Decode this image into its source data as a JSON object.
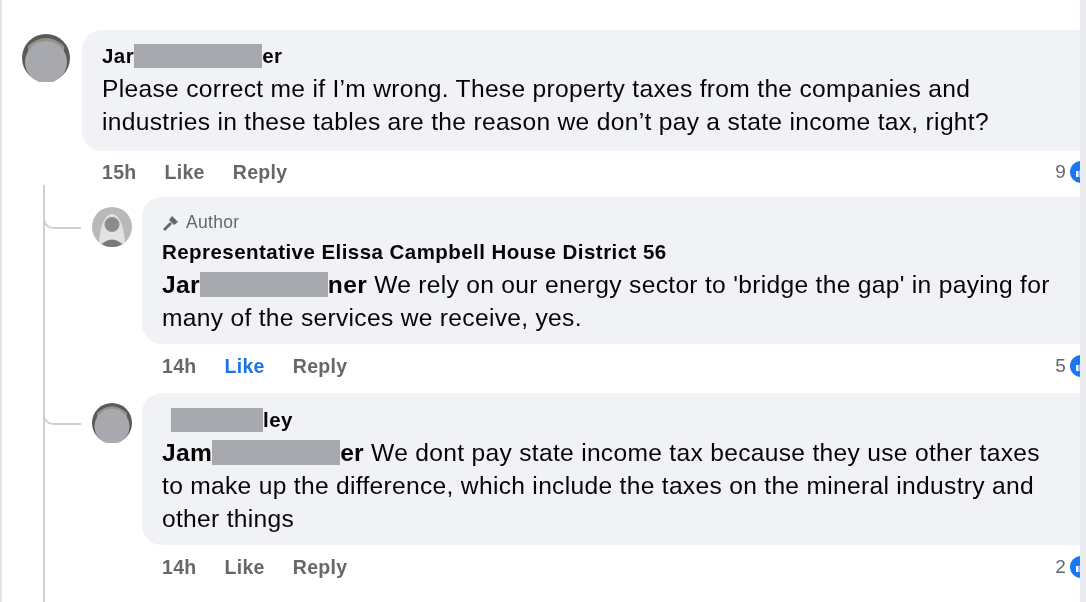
{
  "comments": [
    {
      "avatar": {
        "kind": "redacted"
      },
      "name_start": "Jar",
      "name_end": "er",
      "text_lines": [
        "Please correct me if I’m wrong. These property taxes from the companies and",
        "industries in these tables are the reason we don’t pay a state income tax, right?"
      ],
      "time": "15h",
      "like": "Like",
      "liked": false,
      "reply": "Reply",
      "reaction_count": "9",
      "replies": [
        {
          "avatar": {
            "kind": "photo"
          },
          "badge": "Author",
          "name": "Representative Elissa Campbell House District 56",
          "mention_start": "Jar",
          "text_lines": [
            "**ner** We rely on our energy sector to 'bridge the gap' in paying for",
            "many of the services we receive, yes."
          ],
          "time": "14h",
          "like": "Like",
          "liked": true,
          "reply": "Reply",
          "reaction_count": "5"
        },
        {
          "avatar": {
            "kind": "redacted"
          },
          "name_end": "ley",
          "mention_start": "Jam",
          "text_lines": [
            "**er** We dont pay state income tax because they use other taxes",
            "to make up the difference, which include the taxes on the mineral industry and",
            "other things"
          ],
          "time": "14h",
          "like": "Like",
          "liked": false,
          "reply": "Reply",
          "reaction_count": "2"
        }
      ]
    }
  ]
}
